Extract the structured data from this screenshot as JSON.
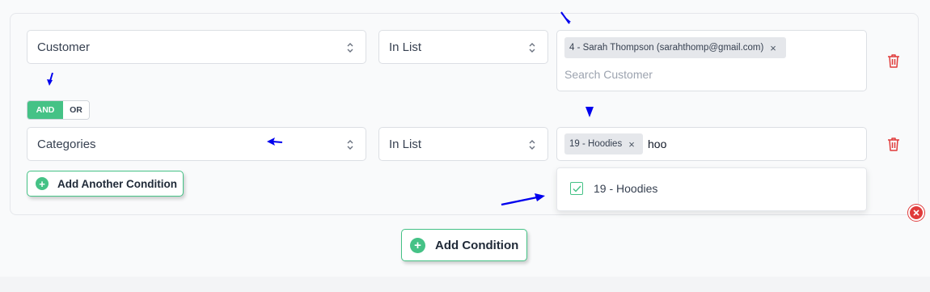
{
  "condition_rows": [
    {
      "field": "Customer",
      "operator": "In List",
      "tags": [
        "4 - Sarah Thompson (sarahthomp@gmail.com)"
      ],
      "search_placeholder": "Search Customer"
    },
    {
      "field": "Categories",
      "operator": "In List",
      "tags": [
        "19 - Hoodies"
      ],
      "typed_value": "hoo"
    }
  ],
  "logic_toggle": {
    "and_label": "AND",
    "or_label": "OR",
    "selected": "AND"
  },
  "tag_remove_glyph": "×",
  "dropdown": {
    "options": [
      {
        "label": "19 - Hoodies",
        "checked": true
      }
    ]
  },
  "add_another_condition_label": "Add Another Condition",
  "add_condition_label": "Add Condition",
  "plus_glyph": "+",
  "colors": {
    "accent": "#45c286",
    "danger": "#e03b3b",
    "annotation_arrow": "#0000ee"
  },
  "icons": [
    "chevron-updown-icon",
    "trash-icon",
    "plus-circle-icon",
    "close-circle-icon",
    "checkbox-checked-icon"
  ]
}
